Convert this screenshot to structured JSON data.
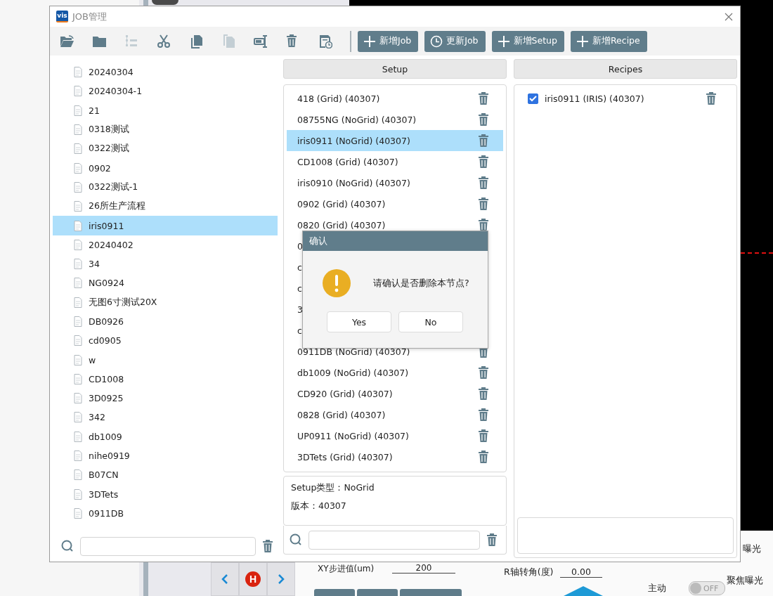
{
  "window": {
    "title": "JOB管理",
    "logo": "vis"
  },
  "toolbar": {
    "tools": [
      {
        "kind": "open",
        "disabled": false
      },
      {
        "kind": "folder",
        "disabled": false
      },
      {
        "kind": "tree",
        "disabled": true
      },
      {
        "kind": "cut",
        "disabled": false
      },
      {
        "kind": "copy",
        "disabled": false
      },
      {
        "kind": "paste",
        "disabled": true
      },
      {
        "kind": "rename",
        "disabled": false
      },
      {
        "kind": "delete",
        "disabled": false
      },
      {
        "kind": "history",
        "disabled": false
      }
    ],
    "buttons": [
      {
        "label": "新增Job",
        "kind": "plus"
      },
      {
        "label": "更新Job",
        "kind": "clock"
      },
      {
        "label": "新增Setup",
        "kind": "plus"
      },
      {
        "label": "新增Recipe",
        "kind": "plus"
      }
    ]
  },
  "jobs": {
    "items": [
      {
        "label": "20240304",
        "selected": false
      },
      {
        "label": "20240304-1",
        "selected": false
      },
      {
        "label": "21",
        "selected": false
      },
      {
        "label": "0318测试",
        "selected": false
      },
      {
        "label": "0322测试",
        "selected": false
      },
      {
        "label": "0902",
        "selected": false
      },
      {
        "label": "0322测试-1",
        "selected": false
      },
      {
        "label": "26所生产流程",
        "selected": false
      },
      {
        "label": "iris0911",
        "selected": true
      },
      {
        "label": "20240402",
        "selected": false
      },
      {
        "label": "34",
        "selected": false
      },
      {
        "label": "NG0924",
        "selected": false
      },
      {
        "label": "无图6寸测试20X",
        "selected": false
      },
      {
        "label": "DB0926",
        "selected": false
      },
      {
        "label": "cd0905",
        "selected": false
      },
      {
        "label": "w",
        "selected": false
      },
      {
        "label": "CD1008",
        "selected": false
      },
      {
        "label": "3D0925",
        "selected": false
      },
      {
        "label": "342",
        "selected": false
      },
      {
        "label": "db1009",
        "selected": false
      },
      {
        "label": "nihe0919",
        "selected": false
      },
      {
        "label": "B07CN",
        "selected": false
      },
      {
        "label": "3DTets",
        "selected": false
      },
      {
        "label": "0911DB",
        "selected": false
      }
    ]
  },
  "setup": {
    "header": "Setup",
    "items": [
      {
        "label": "418 (Grid) (40307)",
        "selected": false
      },
      {
        "label": "08755NG (NoGrid) (40307)",
        "selected": false
      },
      {
        "label": "iris0911 (NoGrid) (40307)",
        "selected": true
      },
      {
        "label": "CD1008 (Grid) (40307)",
        "selected": false
      },
      {
        "label": "iris0910 (NoGrid) (40307)",
        "selected": false
      },
      {
        "label": "0902 (Grid) (40307)",
        "selected": false
      },
      {
        "label": "0820 (Grid) (40307)",
        "selected": false
      },
      {
        "label": "0",
        "selected": false,
        "obscured": true
      },
      {
        "label": "c",
        "selected": false,
        "obscured": true
      },
      {
        "label": "c",
        "selected": false,
        "obscured": true
      },
      {
        "label": "3",
        "selected": false,
        "obscured": true
      },
      {
        "label": "c",
        "selected": false,
        "obscured": true
      },
      {
        "label": "0911DB (NoGrid) (40307)",
        "selected": false
      },
      {
        "label": "db1009 (NoGrid) (40307)",
        "selected": false
      },
      {
        "label": "CD920 (Grid) (40307)",
        "selected": false
      },
      {
        "label": "0828 (Grid) (40307)",
        "selected": false
      },
      {
        "label": "UP0911 (NoGrid) (40307)",
        "selected": false
      },
      {
        "label": "3DTets (Grid) (40307)",
        "selected": false
      }
    ],
    "info": [
      "Setup类型：NoGrid",
      "版本：40307"
    ]
  },
  "recipes": {
    "header": "Recipes",
    "items": [
      {
        "label": "iris0911 (IRIS) (40307)",
        "checked": true
      }
    ]
  },
  "dialog": {
    "title": "确认",
    "message": "请确认是否删除本节点?",
    "buttons": [
      "Yes",
      "No"
    ]
  },
  "background": {
    "home": "H",
    "xy_label": "XY步进值(um)",
    "xy_value": "200",
    "r_label": "R轴转角(度)",
    "r_value": "0.00",
    "exposure_1": "曝光",
    "exposure_2": "聚焦曝光",
    "auto_label": "主动",
    "toggle": {
      "label": "OFF",
      "on": false
    }
  }
}
